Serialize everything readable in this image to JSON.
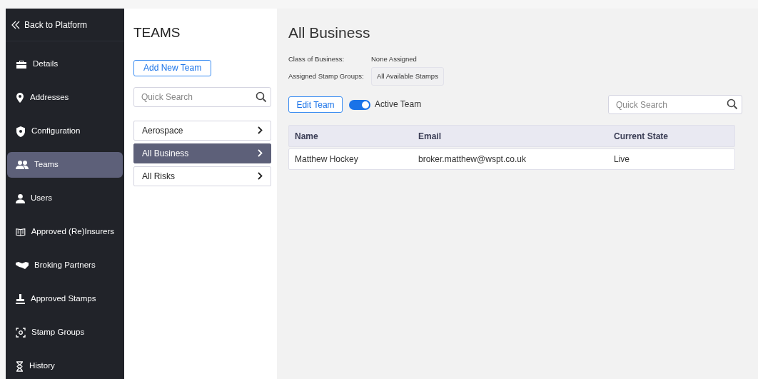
{
  "sidebar": {
    "back_link": "Back to Platform",
    "items": [
      {
        "label": "Details",
        "selected": false
      },
      {
        "label": "Addresses",
        "selected": false
      },
      {
        "label": "Configuration",
        "selected": false
      },
      {
        "label": "Teams",
        "selected": true
      },
      {
        "label": "Users",
        "selected": false
      },
      {
        "label": "Approved (Re)Insurers",
        "selected": false
      },
      {
        "label": "Broking Partners",
        "selected": false
      },
      {
        "label": "Approved Stamps",
        "selected": false
      },
      {
        "label": "Stamp Groups",
        "selected": false
      },
      {
        "label": "History",
        "selected": false
      }
    ]
  },
  "teams_panel": {
    "title": "TEAMS",
    "add_button": "Add New Team",
    "search": {
      "placeholder": "Quick Search"
    },
    "teams": [
      {
        "label": "Aerospace",
        "selected": false
      },
      {
        "label": "All Business",
        "selected": true
      },
      {
        "label": "All Risks",
        "selected": false
      }
    ]
  },
  "team_detail": {
    "title": "All Business",
    "fields": [
      {
        "label": "Class of Business:",
        "value": "None Assigned",
        "kind": "text"
      },
      {
        "label": "Assigned Stamp Groups:",
        "value": "All Available Stamps",
        "kind": "chip"
      }
    ],
    "edit_button": "Edit Team",
    "active_toggle": {
      "label": "Active Team",
      "on": true
    },
    "search": {
      "placeholder": "Quick Search"
    },
    "table": {
      "columns": [
        "Name",
        "Email",
        "Current State"
      ],
      "rows": [
        [
          "Matthew Hockey",
          "broker.matthew@wspt.co.uk",
          "Live"
        ]
      ]
    }
  }
}
